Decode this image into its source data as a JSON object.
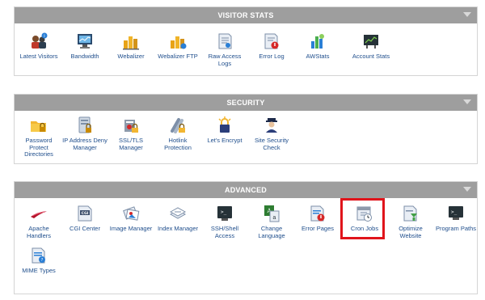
{
  "visitor_stats": {
    "title": "VISITOR STATS",
    "items": [
      {
        "label": "Latest Visitors",
        "icon": "latest-visitors-icon"
      },
      {
        "label": "Bandwidth",
        "icon": "bandwidth-icon"
      },
      {
        "label": "Webalizer",
        "icon": "webalizer-icon"
      },
      {
        "label": "Webalizer FTP",
        "icon": "webalizer-ftp-icon"
      },
      {
        "label": "Raw Access Logs",
        "icon": "raw-access-logs-icon"
      },
      {
        "label": "Error Log",
        "icon": "error-log-icon"
      },
      {
        "label": "AWStats",
        "icon": "awstats-icon"
      },
      {
        "label": "Account Stats",
        "icon": "account-stats-icon"
      }
    ]
  },
  "security": {
    "title": "SECURITY",
    "items": [
      {
        "label": "Password Protect Directories",
        "icon": "password-protect-icon"
      },
      {
        "label": "IP Address Deny Manager",
        "icon": "ip-deny-icon"
      },
      {
        "label": "SSL/TLS Manager",
        "icon": "ssl-tls-icon"
      },
      {
        "label": "Hotlink Protection",
        "icon": "hotlink-protection-icon"
      },
      {
        "label": "Let's Encrypt",
        "icon": "lets-encrypt-icon"
      },
      {
        "label": "Site Security Check",
        "icon": "site-security-icon"
      }
    ]
  },
  "advanced": {
    "title": "ADVANCED",
    "items": [
      {
        "label": "Apache Handlers",
        "icon": "apache-handlers-icon"
      },
      {
        "label": "CGI Center",
        "icon": "cgi-center-icon"
      },
      {
        "label": "Image Manager",
        "icon": "image-manager-icon"
      },
      {
        "label": "Index Manager",
        "icon": "index-manager-icon"
      },
      {
        "label": "SSH/Shell Access",
        "icon": "ssh-shell-icon"
      },
      {
        "label": "Change Language",
        "icon": "change-language-icon"
      },
      {
        "label": "Error Pages",
        "icon": "error-pages-icon"
      },
      {
        "label": "Cron Jobs",
        "icon": "cron-jobs-icon"
      },
      {
        "label": "Optimize Website",
        "icon": "optimize-website-icon"
      },
      {
        "label": "Program Paths",
        "icon": "program-paths-icon"
      },
      {
        "label": "MIME Types",
        "icon": "mime-types-icon"
      }
    ]
  },
  "highlighted_item": "Cron Jobs",
  "colors": {
    "header_bg": "#9e9e9e",
    "header_text": "#ffffff",
    "label_text": "#1f4e8c",
    "highlight_border": "#e0141b"
  }
}
